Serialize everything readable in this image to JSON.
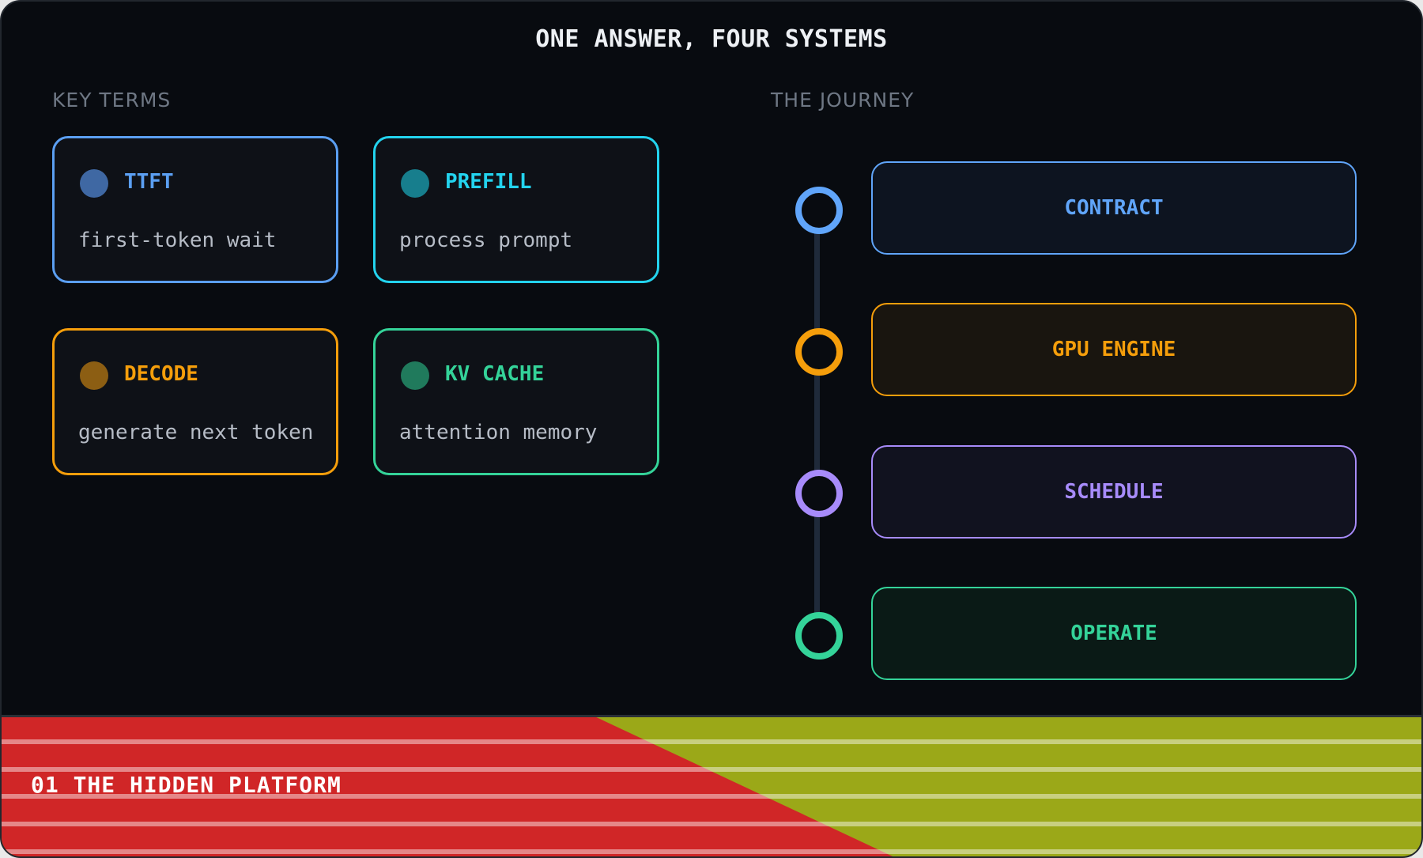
{
  "title": "ONE ANSWER, FOUR SYSTEMS",
  "key_terms": {
    "label": "KEY TERMS",
    "items": [
      {
        "name": "TTFT",
        "desc": "first-token wait",
        "color": "#5b9ff2",
        "dot": "#3f68a3"
      },
      {
        "name": "PREFILL",
        "desc": "process prompt",
        "color": "#23d3ee",
        "dot": "#177e8d"
      },
      {
        "name": "DECODE",
        "desc": "generate next token",
        "color": "#f59e0b",
        "dot": "#8c5e13"
      },
      {
        "name": "KV CACHE",
        "desc": "attention memory",
        "color": "#34d399",
        "dot": "#207a5c"
      }
    ]
  },
  "journey": {
    "label": "THE JOURNEY",
    "stages": [
      {
        "name": "CONTRACT",
        "color": "#60a5fa",
        "fill": "#0d1420"
      },
      {
        "name": "GPU ENGINE",
        "color": "#f59e0b",
        "fill": "#19150f"
      },
      {
        "name": "SCHEDULE",
        "color": "#a78bfa",
        "fill": "#11121f"
      },
      {
        "name": "OPERATE",
        "color": "#34d399",
        "fill": "#0a1a16"
      }
    ]
  },
  "banner": {
    "text": "01 THE HIDDEN PLATFORM",
    "left_color": "#d02627",
    "right_color": "#9ba818"
  }
}
